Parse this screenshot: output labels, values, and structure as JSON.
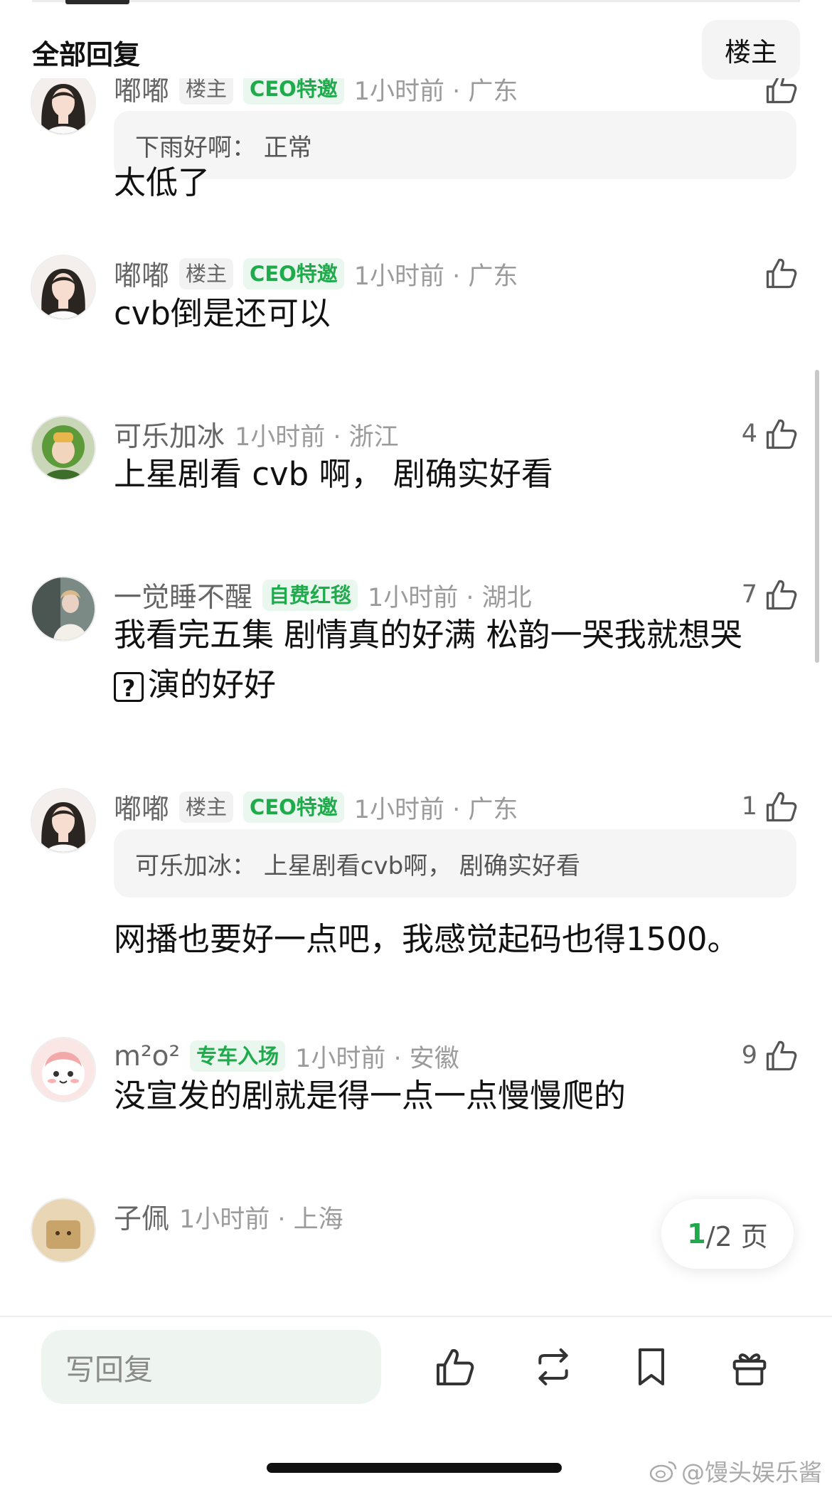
{
  "header": {
    "title": "全部回复",
    "op_button": "楼主"
  },
  "colors": {
    "accent": "#1fab4c",
    "badge_bg": "#eaf7ee"
  },
  "comments": [
    {
      "name": "嘟嘟",
      "badges": [
        "楼主",
        "CEO特邀"
      ],
      "time": "1小时前 · 广东",
      "likes": "",
      "quote": "下雨好啊：  正常",
      "text": "太低了"
    },
    {
      "name": "嘟嘟",
      "badges": [
        "楼主",
        "CEO特邀"
      ],
      "time": "1小时前 · 广东",
      "likes": "",
      "text": "cvb倒是还可以"
    },
    {
      "name": "可乐加冰",
      "time": "1小时前 · 浙江",
      "likes": "4",
      "text": "上星剧看 cvb 啊， 剧确实好看"
    },
    {
      "name": "一觉睡不醒",
      "badges": [
        "自费红毯"
      ],
      "time": "1小时前 · 湖北",
      "likes": "7",
      "text": "我看完五集 剧情真的好满 松韵一哭我就想哭",
      "text2": "演的好好",
      "emoji": "?"
    },
    {
      "name": "嘟嘟",
      "badges": [
        "楼主",
        "CEO特邀"
      ],
      "time": "1小时前 · 广东",
      "likes": "1",
      "quote": "可乐加冰：  上星剧看cvb啊， 剧确实好看",
      "text": "网播也要好一点吧，我感觉起码也得1500。"
    },
    {
      "name": "m²o²",
      "badges": [
        "专车入场"
      ],
      "time": "1小时前 · 安徽",
      "likes": "9",
      "text": "没宣发的剧就是得一点一点慢慢爬的"
    },
    {
      "name": "子佩",
      "time": "1小时前 · 上海"
    }
  ],
  "pagination": {
    "current": "1",
    "total": "/2 页"
  },
  "bottom_bar": {
    "reply_placeholder": "写回复",
    "icons": [
      "thumbs-up-icon",
      "repost-icon",
      "bookmark-icon",
      "gift-icon"
    ]
  },
  "watermark": "@馒头娱乐酱"
}
